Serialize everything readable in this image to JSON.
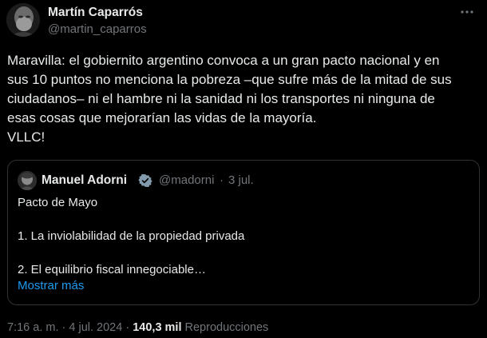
{
  "author": {
    "display_name": "Martín Caparrós",
    "handle": "@martin_caparros"
  },
  "more_icon": "more-horizontal-icon",
  "tweet_text": [
    "Maravilla: el gobiernito argentino convoca a un gran pacto nacional y en",
    "sus 10 puntos no menciona la pobreza –que sufre más de la mitad de sus",
    "ciudadanos– ni el hambre ni la sanidad ni los transportes ni ninguna de",
    "esas cosas que mejorarían las vidas de la mayoría.",
    "VLLC!"
  ],
  "quoted": {
    "display_name": "Manuel Adorni",
    "verified_icon": "verified-badge-icon",
    "handle": "@madorni",
    "separator": "·",
    "date": "3 jul.",
    "lines": [
      "Pacto de Mayo",
      "1. La inviolabilidad de la propiedad privada",
      "2. El equilibrio fiscal innegociable…"
    ],
    "show_more": "Mostrar más"
  },
  "meta": {
    "time": "7:16 a. m.",
    "separator1": "·",
    "date": "4 jul. 2024",
    "separator2": "·",
    "views_count": "140,3 mil",
    "views_label": "Reproducciones"
  },
  "colors": {
    "background": "#000000",
    "text_primary": "#e7e9ea",
    "text_secondary": "#71767b",
    "link_blue": "#1d9bf0",
    "border": "#2f3336",
    "verified_badge": "#829aab"
  }
}
